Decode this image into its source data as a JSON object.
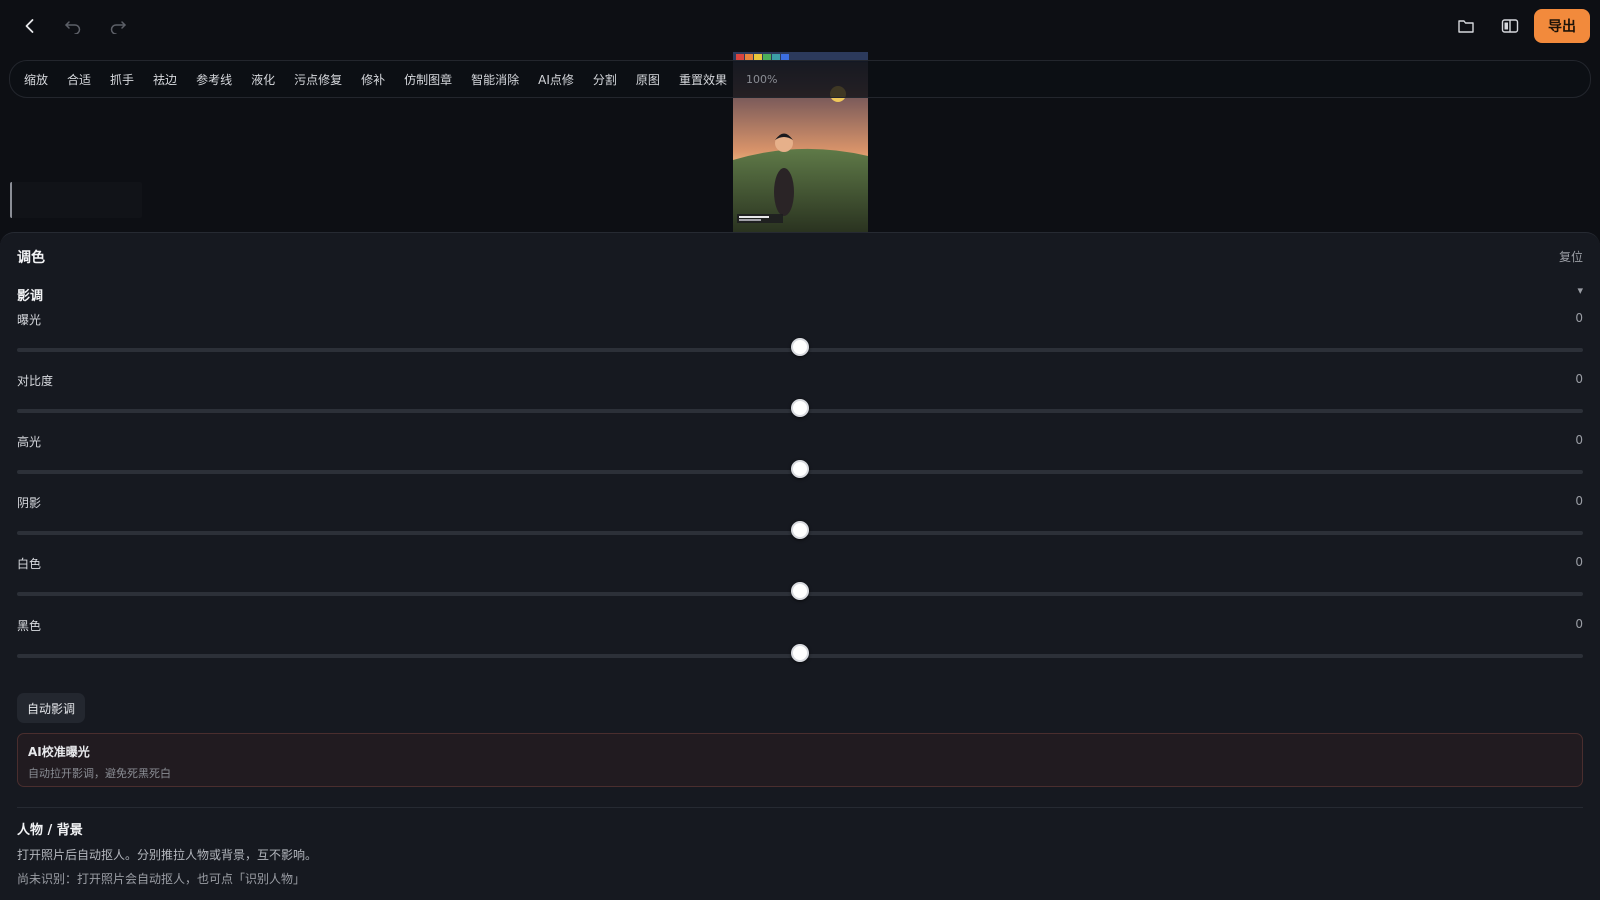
{
  "topbar": {
    "icons": [
      "back-arrow-icon",
      "undo-icon",
      "redo-icon",
      "folder-icon",
      "compare-icon"
    ],
    "export_label": "导出",
    "export_color": "#f28a3c"
  },
  "toolbar": {
    "tools": [
      "缩放",
      "合适",
      "抓手",
      "祛边",
      "参考线",
      "液化",
      "污点修复",
      "修补",
      "仿制图章",
      "智能消除",
      "AI点修",
      "分割",
      "原图",
      "重置效果"
    ],
    "zoom": "100%"
  },
  "panel": {
    "title": "调色",
    "reset_label": "复位",
    "tone_section": {
      "title": "影调",
      "toggle": "▾",
      "sliders": [
        {
          "label": "曝光",
          "value": "0",
          "fraction": 0.5
        },
        {
          "label": "对比度",
          "value": "0",
          "fraction": 0.5
        },
        {
          "label": "高光",
          "value": "0",
          "fraction": 0.5
        },
        {
          "label": "阴影",
          "value": "0",
          "fraction": 0.5
        },
        {
          "label": "白色",
          "value": "0",
          "fraction": 0.5
        },
        {
          "label": "黑色",
          "value": "0",
          "fraction": 0.5
        }
      ],
      "auto_tone_label": "自动影调",
      "ai_exposure": {
        "title": "AI校准曝光",
        "subtitle": "自动拉开影调，避免死黑死白"
      }
    },
    "people_section": {
      "title": "人物 / 背景",
      "description": "打开照片后自动抠人。分别推拉人物或背景，互不影响。",
      "status": "尚未识别：打开照片会自动抠人，也可点「识别人物」"
    }
  },
  "colors": {
    "accent": "#f28a3c",
    "background": "#0d0f14",
    "panel": "#161920"
  }
}
